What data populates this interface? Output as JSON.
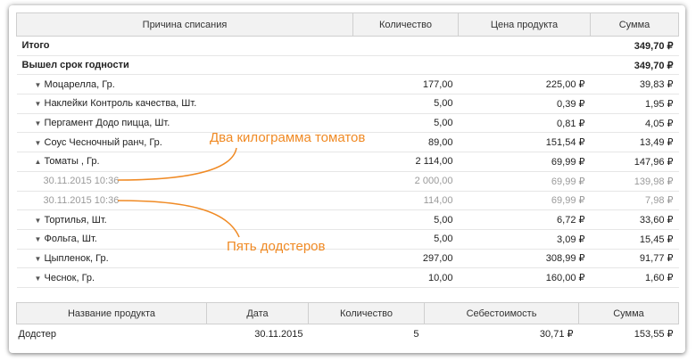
{
  "writeoff_table": {
    "headers": [
      "Причина списания",
      "Количество",
      "Цена продукта",
      "Сумма"
    ],
    "total": {
      "label": "Итого",
      "sum": "349,70 ₽"
    },
    "group": {
      "label": "Вышел срок годности",
      "sum": "349,70 ₽"
    },
    "rows": [
      {
        "type": "item",
        "expanded": false,
        "name": "Моцарелла, Гр.",
        "qty": "177,00",
        "price": "225,00 ₽",
        "sum": "39,83 ₽"
      },
      {
        "type": "item",
        "expanded": false,
        "name": "Наклейки Контроль качества, Шт.",
        "qty": "5,00",
        "price": "0,39 ₽",
        "sum": "1,95 ₽"
      },
      {
        "type": "item",
        "expanded": false,
        "name": "Пергамент Додо пицца, Шт.",
        "qty": "5,00",
        "price": "0,81 ₽",
        "sum": "4,05 ₽"
      },
      {
        "type": "item",
        "expanded": false,
        "name": "Соус Чесночный ранч, Гр.",
        "qty": "89,00",
        "price": "151,54 ₽",
        "sum": "13,49 ₽"
      },
      {
        "type": "item",
        "expanded": true,
        "name": "Томаты , Гр.",
        "qty": "2 114,00",
        "price": "69,99 ₽",
        "sum": "147,96 ₽"
      },
      {
        "type": "sub",
        "name": "30.11.2015 10:36",
        "qty": "2 000,00",
        "price": "69,99 ₽",
        "sum": "139,98 ₽"
      },
      {
        "type": "sub",
        "name": "30.11.2015 10:36",
        "qty": "114,00",
        "price": "69,99 ₽",
        "sum": "7,98 ₽"
      },
      {
        "type": "item",
        "expanded": false,
        "name": "Тортилья, Шт.",
        "qty": "5,00",
        "price": "6,72 ₽",
        "sum": "33,60 ₽"
      },
      {
        "type": "item",
        "expanded": false,
        "name": "Фольга, Шт.",
        "qty": "5,00",
        "price": "3,09 ₽",
        "sum": "15,45 ₽"
      },
      {
        "type": "item",
        "expanded": false,
        "name": "Цыпленок, Гр.",
        "qty": "297,00",
        "price": "308,99 ₽",
        "sum": "91,77 ₽"
      },
      {
        "type": "item",
        "expanded": false,
        "name": "Чеснок, Гр.",
        "qty": "10,00",
        "price": "160,00 ₽",
        "sum": "1,60 ₽"
      }
    ]
  },
  "product_table": {
    "headers": [
      "Название продукта",
      "Дата",
      "Количество",
      "Себестоимость",
      "Сумма"
    ],
    "rows": [
      {
        "name": "Додстер",
        "date": "30.11.2015",
        "qty": "5",
        "cost": "30,71 ₽",
        "sum": "153,55 ₽"
      }
    ]
  },
  "annotations": {
    "tomatoes": "Два килограмма томатов",
    "dodsters": "Пять додстеров"
  },
  "colors": {
    "annotation": "#f08a24",
    "header_bg": "#f2f2f2",
    "muted_text": "#9a9a9a"
  },
  "icons": {
    "collapsed": "chevron-down-icon",
    "expanded": "chevron-up-icon"
  }
}
